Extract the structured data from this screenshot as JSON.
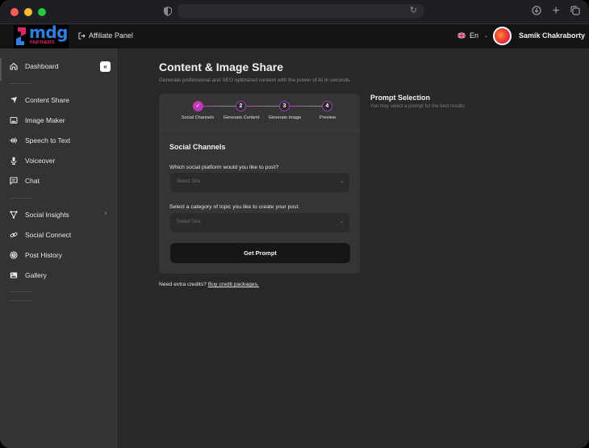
{
  "browser": {
    "icons": [
      "shield-icon",
      "reload-icon",
      "download-icon",
      "new-tab-icon",
      "tabs-overview-icon"
    ]
  },
  "header": {
    "logo": {
      "text": "mdg",
      "subtext": "PARTNERS",
      "colors": {
        "primary": "#2d7fe0",
        "accent": "#e0246a"
      }
    },
    "affiliate_link": "Affiliate Panel",
    "language": "En",
    "user_name": "Samik Chakraborty"
  },
  "sidebar": {
    "items": [
      {
        "label": "Dashboard",
        "icon": "home-icon",
        "active": true
      },
      {
        "label": "Content Share",
        "icon": "send-icon"
      },
      {
        "label": "Image Maker",
        "icon": "image-icon"
      },
      {
        "label": "Speech to Text",
        "icon": "waveform-icon"
      },
      {
        "label": "Voiceover",
        "icon": "microphone-icon"
      },
      {
        "label": "Chat",
        "icon": "chat-icon"
      },
      {
        "label": "Social Insights",
        "icon": "insights-icon",
        "has_submenu": true
      },
      {
        "label": "Social Connect",
        "icon": "link-icon"
      },
      {
        "label": "Post History",
        "icon": "history-icon"
      },
      {
        "label": "Gallery",
        "icon": "gallery-icon"
      }
    ],
    "collapse_label": "«"
  },
  "main": {
    "title": "Content & Image Share",
    "subtitle": "Generate professional and SEO optimized content with the power of AI in seconds.",
    "stepper": {
      "steps": [
        {
          "number": "✓",
          "label": "Social Channels",
          "done": true
        },
        {
          "number": "2",
          "label": "Generate Content"
        },
        {
          "number": "3",
          "label": "Generate Image"
        },
        {
          "number": "4",
          "label": "Preview"
        }
      ],
      "accent_color": "#c13bb0"
    },
    "form": {
      "section_title": "Social Channels",
      "platform_label": "Which social platform would you like to post?",
      "platform_placeholder": "Select One",
      "category_label": "Select a category of topic you like to create your post.",
      "category_placeholder": "Select One",
      "submit_label": "Get Prompt"
    },
    "credits": {
      "text": "Need extra credits?",
      "link": "Buy credit packages."
    },
    "prompt_selection": {
      "title": "Prompt Selection",
      "subtitle": "You may select a prompt for the best results"
    }
  }
}
